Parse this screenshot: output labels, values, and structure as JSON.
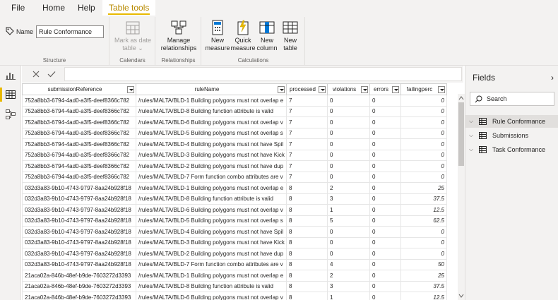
{
  "ribbon": {
    "tabs": [
      "File",
      "Home",
      "Help",
      "Table tools"
    ],
    "active_tab": "Table tools",
    "structure": {
      "name_label": "Name",
      "name_value": "Rule Conformance",
      "group_label": "Structure"
    },
    "calendars": {
      "mark_as_date_table": "Mark as date table",
      "group_label": "Calendars"
    },
    "relationships": {
      "manage_relationships": "Manage relationships",
      "group_label": "Relationships"
    },
    "calculations": {
      "new_measure": "New measure",
      "quick_measure": "Quick measure",
      "new_column": "New column",
      "new_table": "New table",
      "group_label": "Calculations"
    }
  },
  "table": {
    "columns": [
      "submissionReference",
      "ruleName",
      "processed",
      "violations",
      "errors",
      "failingperc"
    ],
    "rows": [
      [
        "752a8bb3-6794-4ad0-a3f5-deef8366c782",
        "/rules/MALTA/BLD-1 Building polygons must not overlap e",
        "7",
        "0",
        "0",
        "0"
      ],
      [
        "752a8bb3-6794-4ad0-a3f5-deef8366c782",
        "/rules/MALTA/BLD-8 Building function attribute is valid",
        "7",
        "0",
        "0",
        "0"
      ],
      [
        "752a8bb3-6794-4ad0-a3f5-deef8366c782",
        "/rules/MALTA/BLD-6 Building polygons must not overlap v",
        "7",
        "0",
        "0",
        "0"
      ],
      [
        "752a8bb3-6794-4ad0-a3f5-deef8366c782",
        "/rules/MALTA/BLD-5 Building polygons must not overlap s",
        "7",
        "0",
        "0",
        "0"
      ],
      [
        "752a8bb3-6794-4ad0-a3f5-deef8366c782",
        "/rules/MALTA/BLD-4 Building polygons must not have Spil",
        "7",
        "0",
        "0",
        "0"
      ],
      [
        "752a8bb3-6794-4ad0-a3f5-deef8366c782",
        "/rules/MALTA/BLD-3 Building polygons must not have Kick",
        "7",
        "0",
        "0",
        "0"
      ],
      [
        "752a8bb3-6794-4ad0-a3f5-deef8366c782",
        "/rules/MALTA/BLD-2 Building polygons must not have dup",
        "7",
        "0",
        "0",
        "0"
      ],
      [
        "752a8bb3-6794-4ad0-a3f5-deef8366c782",
        "/rules/MALTA/BLD-7 Form function combo attributes are v",
        "7",
        "0",
        "0",
        "0"
      ],
      [
        "032d3a83-9b10-4743-9797-8aa24b928f18",
        "/rules/MALTA/BLD-1 Building polygons must not overlap e",
        "8",
        "2",
        "0",
        "25"
      ],
      [
        "032d3a83-9b10-4743-9797-8aa24b928f18",
        "/rules/MALTA/BLD-8 Building function attribute is valid",
        "8",
        "3",
        "0",
        "37.5"
      ],
      [
        "032d3a83-9b10-4743-9797-8aa24b928f18",
        "/rules/MALTA/BLD-6 Building polygons must not overlap v",
        "8",
        "1",
        "0",
        "12.5"
      ],
      [
        "032d3a83-9b10-4743-9797-8aa24b928f18",
        "/rules/MALTA/BLD-5 Building polygons must not overlap s",
        "8",
        "5",
        "0",
        "62.5"
      ],
      [
        "032d3a83-9b10-4743-9797-8aa24b928f18",
        "/rules/MALTA/BLD-4 Building polygons must not have Spil",
        "8",
        "0",
        "0",
        "0"
      ],
      [
        "032d3a83-9b10-4743-9797-8aa24b928f18",
        "/rules/MALTA/BLD-3 Building polygons must not have Kick",
        "8",
        "0",
        "0",
        "0"
      ],
      [
        "032d3a83-9b10-4743-9797-8aa24b928f18",
        "/rules/MALTA/BLD-2 Building polygons must not have dup",
        "8",
        "0",
        "0",
        "0"
      ],
      [
        "032d3a83-9b10-4743-9797-8aa24b928f18",
        "/rules/MALTA/BLD-7 Form function combo attributes are v",
        "8",
        "4",
        "0",
        "50"
      ],
      [
        "21aca02a-846b-48ef-b9de-7603272d3393",
        "/rules/MALTA/BLD-1 Building polygons must not overlap e",
        "8",
        "2",
        "0",
        "25"
      ],
      [
        "21aca02a-846b-48ef-b9de-7603272d3393",
        "/rules/MALTA/BLD-8 Building function attribute is valid",
        "8",
        "3",
        "0",
        "37.5"
      ],
      [
        "21aca02a-846b-48ef-b9de-7603272d3393",
        "/rules/MALTA/BLD-6 Building polygons must not overlap v",
        "8",
        "1",
        "0",
        "12.5"
      ]
    ]
  },
  "fields_pane": {
    "title": "Fields",
    "search_placeholder": "Search",
    "tables": [
      "Rule Conformance",
      "Submissions",
      "Task Conformance"
    ],
    "selected": "Rule Conformance"
  },
  "colors": {
    "accent": "#e8b900",
    "active_tab_text": "#b88a00",
    "chrome": "#f3f2f1"
  }
}
